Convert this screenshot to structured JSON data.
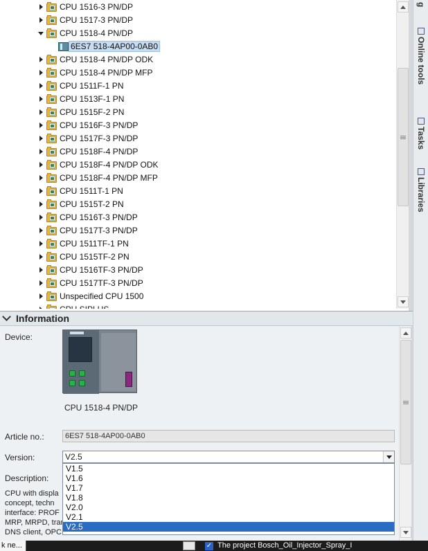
{
  "tree": {
    "items": [
      {
        "label": "CPU 1516-3 PN/DP",
        "type": "folder",
        "expanded": false
      },
      {
        "label": "CPU 1517-3 PN/DP",
        "type": "folder",
        "expanded": false
      },
      {
        "label": "CPU 1518-4 PN/DP",
        "type": "folder",
        "expanded": true
      },
      {
        "label": "6ES7 518-4AP00-0AB0",
        "type": "module",
        "selected": true
      },
      {
        "label": "CPU 1518-4 PN/DP ODK",
        "type": "folder",
        "expanded": false
      },
      {
        "label": "CPU 1518-4 PN/DP MFP",
        "type": "folder",
        "expanded": false
      },
      {
        "label": "CPU 1511F-1 PN",
        "type": "folder",
        "expanded": false
      },
      {
        "label": "CPU 1513F-1 PN",
        "type": "folder",
        "expanded": false
      },
      {
        "label": "CPU 1515F-2 PN",
        "type": "folder",
        "expanded": false
      },
      {
        "label": "CPU 1516F-3 PN/DP",
        "type": "folder",
        "expanded": false
      },
      {
        "label": "CPU 1517F-3 PN/DP",
        "type": "folder",
        "expanded": false
      },
      {
        "label": "CPU 1518F-4 PN/DP",
        "type": "folder",
        "expanded": false
      },
      {
        "label": "CPU 1518F-4 PN/DP ODK",
        "type": "folder",
        "expanded": false
      },
      {
        "label": "CPU 1518F-4 PN/DP MFP",
        "type": "folder",
        "expanded": false
      },
      {
        "label": "CPU 1511T-1 PN",
        "type": "folder",
        "expanded": false
      },
      {
        "label": "CPU 1515T-2 PN",
        "type": "folder",
        "expanded": false
      },
      {
        "label": "CPU 1516T-3 PN/DP",
        "type": "folder",
        "expanded": false
      },
      {
        "label": "CPU 1517T-3 PN/DP",
        "type": "folder",
        "expanded": false
      },
      {
        "label": "CPU 1511TF-1 PN",
        "type": "folder",
        "expanded": false
      },
      {
        "label": "CPU 1515TF-2 PN",
        "type": "folder",
        "expanded": false
      },
      {
        "label": "CPU 1516TF-3 PN/DP",
        "type": "folder",
        "expanded": false
      },
      {
        "label": "CPU 1517TF-3 PN/DP",
        "type": "folder",
        "expanded": false
      },
      {
        "label": "Unspecified CPU 1500",
        "type": "folder",
        "expanded": false
      },
      {
        "label": "CPU SIPLUS",
        "type": "folder",
        "expanded": false
      }
    ]
  },
  "side_tabs": {
    "online_tools": "Online tools",
    "tasks": "Tasks",
    "libraries": "Libraries",
    "top_fragment": "g"
  },
  "info": {
    "header": "Information",
    "device_label": "Device:",
    "device_name": "CPU 1518-4 PN/DP",
    "article_label": "Article no.:",
    "article_value": "6ES7 518-4AP00-0AB0",
    "version_label": "Version:",
    "version_value": "V2.5",
    "description_label": "Description:",
    "description_lines": [
      "CPU with displa",
      "concept, techn",
      "interface: PROF",
      "MRP, MRPD, tran",
      "DNS client, OPC"
    ],
    "version_options": [
      "V1.5",
      "V1.6",
      "V1.7",
      "V1.8",
      "V2.0",
      "V2.1",
      "V2.5"
    ],
    "selected_option": "V2.5"
  },
  "taskbar": {
    "left_button": "k ne...",
    "status_text": "The project Bosch_Oil_Injector_Spray_I"
  },
  "colors": {
    "accent": "#2a6bc4",
    "folder": "#e8b53c",
    "panel_bg": "#eef1f4"
  }
}
